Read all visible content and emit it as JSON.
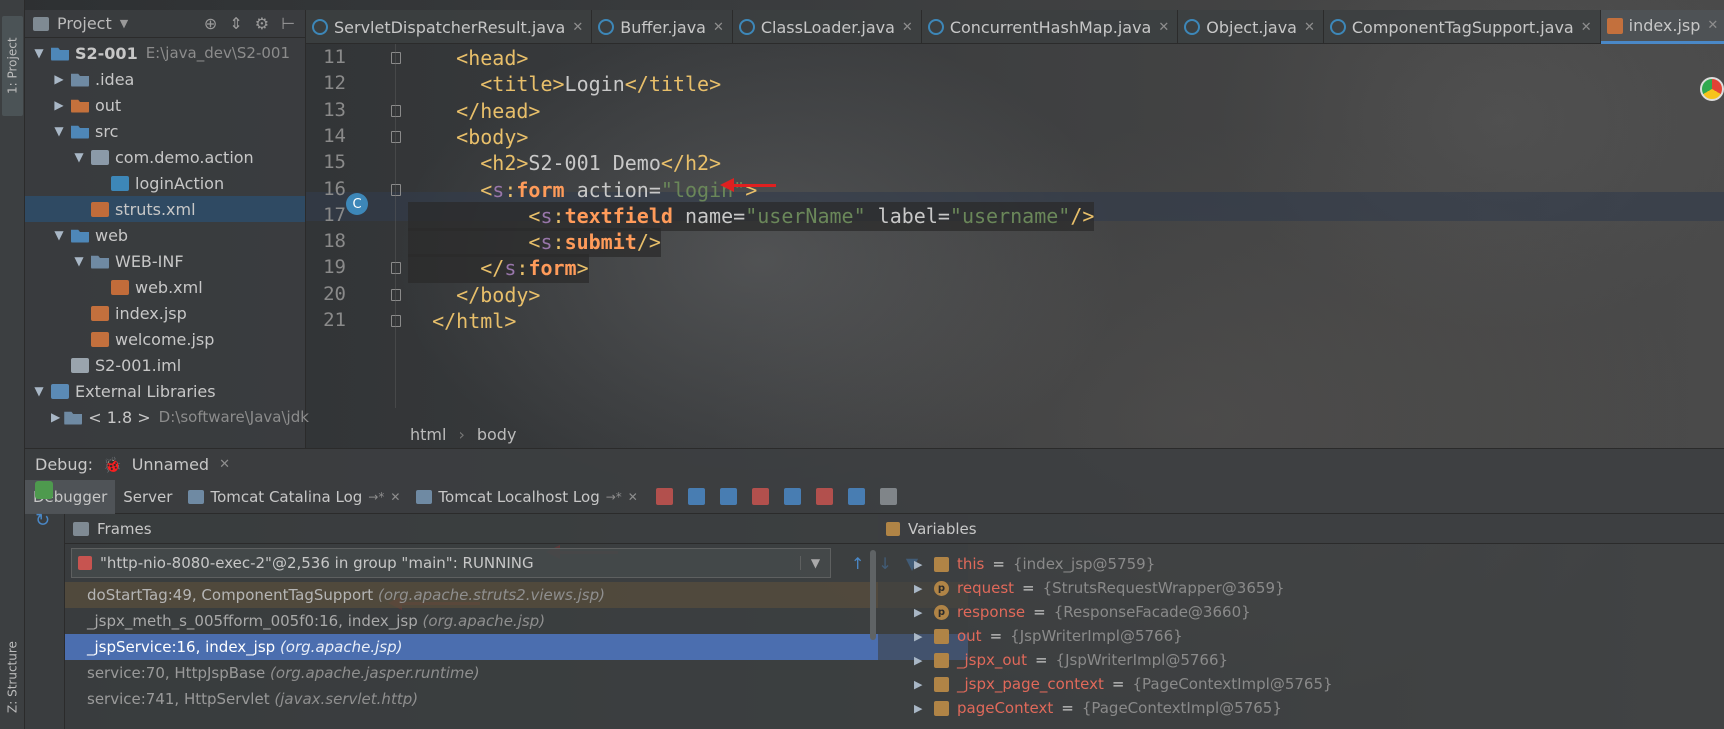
{
  "left_strip": {
    "project_tab": "1: Project",
    "structure_tab": "Z: Structure"
  },
  "project": {
    "header_title": "Project",
    "tree": [
      {
        "label": "S2-001",
        "path": "E:\\java_dev\\S2-001",
        "icon": "module-icon",
        "indent": 0,
        "arrow": "▼"
      },
      {
        "label": ".idea",
        "icon": "folder-icon",
        "indent": 1,
        "arrow": "▶"
      },
      {
        "label": "out",
        "icon": "folder-orange-icon",
        "indent": 1,
        "arrow": "▶"
      },
      {
        "label": "src",
        "icon": "folder-blue-icon",
        "indent": 1,
        "arrow": "▼"
      },
      {
        "label": "com.demo.action",
        "icon": "package-icon",
        "indent": 2,
        "arrow": "▼"
      },
      {
        "label": "loginAction",
        "icon": "class-icon",
        "indent": 3,
        "arrow": ""
      },
      {
        "label": "struts.xml",
        "icon": "xml-icon",
        "indent": 2,
        "arrow": "",
        "selected": true
      },
      {
        "label": "web",
        "icon": "folder-blue-icon",
        "indent": 1,
        "arrow": "▼"
      },
      {
        "label": "WEB-INF",
        "icon": "folder-icon",
        "indent": 2,
        "arrow": "▼"
      },
      {
        "label": "web.xml",
        "icon": "xml-icon",
        "indent": 3,
        "arrow": ""
      },
      {
        "label": "index.jsp",
        "icon": "jsp-icon",
        "indent": 2,
        "arrow": ""
      },
      {
        "label": "welcome.jsp",
        "icon": "jsp-icon",
        "indent": 2,
        "arrow": ""
      },
      {
        "label": "S2-001.iml",
        "icon": "iml-icon",
        "indent": 1,
        "arrow": ""
      },
      {
        "label": "External Libraries",
        "icon": "library-icon",
        "indent": 0,
        "arrow": "▼"
      },
      {
        "label": "< 1.8 >",
        "path": "D:\\software\\Java\\jdk",
        "icon": "jdk-icon",
        "indent": 1,
        "arrow": "▶"
      }
    ]
  },
  "editor": {
    "tabs": [
      {
        "label": "ServletDispatcherResult.java",
        "icon": "class-icon"
      },
      {
        "label": "Buffer.java",
        "icon": "class-icon"
      },
      {
        "label": "ClassLoader.java",
        "icon": "class-icon"
      },
      {
        "label": "ConcurrentHashMap.java",
        "icon": "class-icon"
      },
      {
        "label": "Object.java",
        "icon": "class-icon"
      },
      {
        "label": "ComponentTagSupport.java",
        "icon": "class-icon"
      },
      {
        "label": "index.jsp",
        "icon": "jsp-icon",
        "active": true
      }
    ],
    "line_numbers": [
      "11",
      "12",
      "13",
      "14",
      "15",
      "16",
      "17",
      "18",
      "19",
      "20",
      "21"
    ],
    "code_lines": [
      "    <head>",
      "      <title>Login</title>",
      "    </head>",
      "    <body>",
      "      <h2>S2-001 Demo</h2>",
      "      <s:form action=\"login\">",
      "          <s:textfield name=\"userName\" label=\"username\"/>",
      "          <s:submit/>",
      "      </s:form>",
      "    </body>",
      "  </html>"
    ],
    "breadcrumb": [
      "html",
      "body"
    ]
  },
  "debug": {
    "label": "Debug:",
    "config_name": "Unnamed",
    "tabs": [
      {
        "label": "Debugger",
        "active": true
      },
      {
        "label": "Server"
      },
      {
        "label": "Tomcat Catalina Log",
        "suffix": "→*"
      },
      {
        "label": "Tomcat Localhost Log",
        "suffix": "→*"
      }
    ],
    "frames_title": "Frames",
    "thread": "\"http-nio-8080-exec-2\"@2,536 in group \"main\": RUNNING",
    "frames": [
      {
        "method": "doStartTag:49, ComponentTagSupport",
        "pkg": "(org.apache.struts2.views.jsp)",
        "style": "highlight"
      },
      {
        "method": "_jspx_meth_s_005fform_005f0:16, index_jsp",
        "pkg": "(org.apache.jsp)",
        "style": "normal"
      },
      {
        "method": "_jspService:16, index_jsp",
        "pkg": "(org.apache.jsp)",
        "style": "current"
      },
      {
        "method": "service:70, HttpJspBase",
        "pkg": "(org.apache.jasper.runtime)",
        "style": "dim"
      },
      {
        "method": "service:741, HttpServlet",
        "pkg": "(javax.servlet.http)",
        "style": "dim"
      }
    ],
    "variables_title": "Variables",
    "variables": [
      {
        "name": "this",
        "value": "{index_jsp@5759}",
        "icon": "field-icon"
      },
      {
        "name": "request",
        "value": "{StrutsRequestWrapper@3659}",
        "icon": "param-icon"
      },
      {
        "name": "response",
        "value": "{ResponseFacade@3660}",
        "icon": "param-icon"
      },
      {
        "name": "out",
        "value": "{JspWriterImpl@5766}",
        "icon": "field-icon"
      },
      {
        "name": "_jspx_out",
        "value": "{JspWriterImpl@5766}",
        "icon": "field-icon"
      },
      {
        "name": "_jspx_page_context",
        "value": "{PageContextImpl@5765}",
        "icon": "field-icon"
      },
      {
        "name": "pageContext",
        "value": "{PageContextImpl@5765}",
        "icon": "field-icon"
      }
    ]
  },
  "colors": {
    "accent_blue": "#4b6eaf",
    "arrow_red": "#e02020",
    "tag_yellow": "#e8bf6a",
    "string_green": "#6a8759",
    "var_name_red": "#e0695a"
  }
}
